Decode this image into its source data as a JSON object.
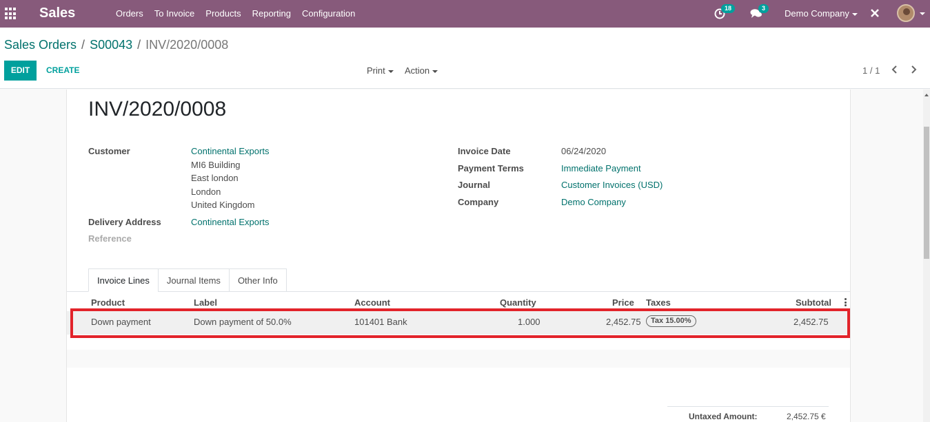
{
  "navbar": {
    "app_name": "Sales",
    "menu": [
      "Orders",
      "To Invoice",
      "Products",
      "Reporting",
      "Configuration"
    ],
    "activity_count": "18",
    "message_count": "3",
    "company": "Demo Company",
    "color": "#875a7b"
  },
  "control_panel": {
    "breadcrumb": [
      "Sales Orders",
      "S00043",
      "INV/2020/0008"
    ],
    "edit_label": "EDIT",
    "create_label": "CREATE",
    "print_label": "Print",
    "action_label": "Action",
    "pager": "1 / 1"
  },
  "invoice": {
    "title": "INV/2020/0008",
    "customer_label": "Customer",
    "customer_name": "Continental Exports",
    "address": [
      "MI6 Building",
      "East london",
      "London",
      "United Kingdom"
    ],
    "delivery_label": "Delivery Address",
    "delivery_value": "Continental Exports",
    "reference_label": "Reference",
    "invoice_date_label": "Invoice Date",
    "invoice_date": "06/24/2020",
    "payment_terms_label": "Payment Terms",
    "payment_terms": "Immediate Payment",
    "journal_label": "Journal",
    "journal": "Customer Invoices (USD)",
    "company_label": "Company",
    "company": "Demo Company"
  },
  "tabs": [
    "Invoice Lines",
    "Journal Items",
    "Other Info"
  ],
  "lines_table": {
    "headers": [
      "Product",
      "Label",
      "Account",
      "Quantity",
      "Price",
      "Taxes",
      "Subtotal"
    ],
    "rows": [
      {
        "product": "Down payment",
        "label": "Down payment of 50.0%",
        "account": "101401 Bank",
        "quantity": "1.000",
        "price": "2,452.75",
        "taxes": "Tax 15.00%",
        "subtotal": "2,452.75"
      }
    ]
  },
  "totals": {
    "untaxed_label": "Untaxed Amount:",
    "untaxed_value": "2,452.75 €"
  },
  "colors": {
    "accent": "#00a09d",
    "link": "#00716c",
    "highlight": "#e2232a"
  }
}
